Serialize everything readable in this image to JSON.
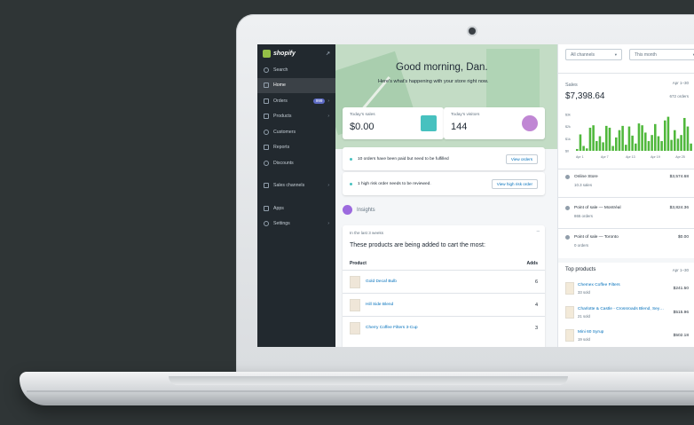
{
  "sidebar": {
    "brand": "shopify",
    "items": [
      {
        "label": "Search",
        "icon": "search-icon"
      },
      {
        "label": "Home",
        "icon": "home-icon",
        "active": true
      },
      {
        "label": "Orders",
        "icon": "orders-icon",
        "badge": "999"
      },
      {
        "label": "Products",
        "icon": "tag-icon"
      },
      {
        "label": "Customers",
        "icon": "person-icon"
      },
      {
        "label": "Reports",
        "icon": "bar-chart-icon"
      },
      {
        "label": "Discounts",
        "icon": "discount-icon"
      },
      {
        "label": "Sales channels",
        "icon": "store-icon"
      },
      {
        "label": "Apps",
        "icon": "apps-icon"
      },
      {
        "label": "Settings",
        "icon": "gear-icon"
      }
    ]
  },
  "hero": {
    "greeting": "Good morning, Dan.",
    "subtitle": "Here's what's happening with your store right now."
  },
  "stats": [
    {
      "label": "Today's sales",
      "value": "$0.00",
      "icon": "cash-register-icon"
    },
    {
      "label": "Today's visitors",
      "value": "144",
      "icon": "visitors-icon"
    }
  ],
  "tasks": [
    {
      "text": "10 orders have been paid but need to be fulfilled",
      "button": "View orders"
    },
    {
      "text": "1 high risk order needs to be reviewed.",
      "button": "View high risk order"
    }
  ],
  "insights": {
    "heading": "Insights",
    "meta": "In the last 3 weeks",
    "title": "These products are being added to cart the most:",
    "col_product": "Product",
    "col_adds": "Adds",
    "rows": [
      {
        "name": "Gold Decaf Bulb",
        "adds": "6"
      },
      {
        "name": "Hill Side Blend",
        "adds": "4"
      },
      {
        "name": "Cherry Coffee Filters 3-Cup",
        "adds": "3"
      }
    ]
  },
  "filters": {
    "channels": "All channels",
    "period": "This month"
  },
  "sales": {
    "label": "Sales",
    "date_range": "Apr 1–30",
    "total": "$7,398.64",
    "orders": "672 orders",
    "channels": [
      {
        "name": "Online Store",
        "orders": "10.3 sales",
        "amount": "$3,574.68"
      },
      {
        "name": "Point of sale — Montréal",
        "orders": "865 orders",
        "amount": "$3,824.36"
      },
      {
        "name": "Point of sale — Toronto",
        "orders": "0 orders",
        "amount": "$0.00"
      }
    ]
  },
  "top_products": {
    "heading": "Top products",
    "date_range": "Apr 1–30",
    "rows": [
      {
        "name": "Chemex Coffee Filters",
        "sold": "33 sold",
        "amount": "$241.50"
      },
      {
        "name": "Charlotte & Castle - Crossroads Blend, Sey…",
        "sold": "21 sold",
        "amount": "$515.96"
      },
      {
        "name": "Mini 60 Syrup",
        "sold": "19 sold",
        "amount": "$502.18"
      }
    ]
  },
  "chart_data": {
    "type": "bar",
    "title": "",
    "xlabel": "",
    "ylabel": "",
    "x_ticks": [
      "Apr 1",
      "Apr 7",
      "Apr 13",
      "Apr 19",
      "Apr 25"
    ],
    "y_ticks": [
      "$0",
      "$1k",
      "$2k",
      "$3k"
    ],
    "ylim": [
      0,
      3500
    ],
    "values": [
      150,
      1350,
      400,
      200,
      1900,
      2100,
      800,
      1200,
      700,
      2050,
      1900,
      400,
      1100,
      1700,
      2050,
      500,
      2000,
      1250,
      600,
      2250,
      2100,
      1500,
      800,
      1300,
      2200,
      1200,
      800,
      2500,
      2800,
      900,
      1700,
      1000,
      1300,
      2700,
      2000,
      600
    ],
    "color": "#50b83c"
  }
}
